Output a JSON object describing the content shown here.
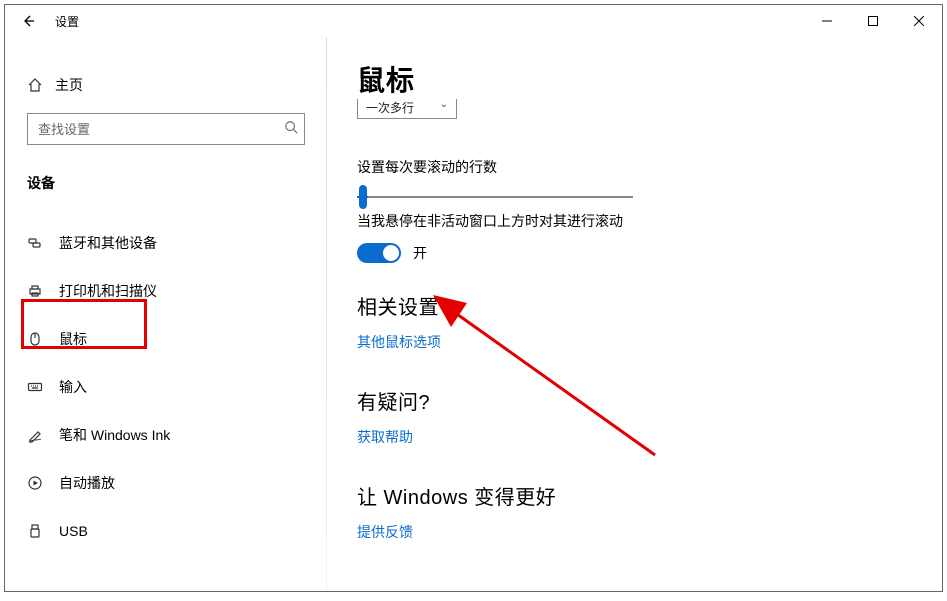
{
  "window": {
    "title": "设置"
  },
  "sidebar": {
    "home": "主页",
    "search_placeholder": "查找设置",
    "section": "设备",
    "items": [
      {
        "id": "bluetooth",
        "label": "蓝牙和其他设备"
      },
      {
        "id": "printers",
        "label": "打印机和扫描仪"
      },
      {
        "id": "mouse",
        "label": "鼠标"
      },
      {
        "id": "typing",
        "label": "输入"
      },
      {
        "id": "pen",
        "label": "笔和 Windows Ink"
      },
      {
        "id": "autoplay",
        "label": "自动播放"
      },
      {
        "id": "usb",
        "label": "USB"
      }
    ]
  },
  "content": {
    "heading": "鼠标",
    "dropdown": {
      "value": "一次多行"
    },
    "scroll_lines_label": "设置每次要滚动的行数",
    "inactive_scroll_label": "当我悬停在非活动窗口上方时对其进行滚动",
    "toggle_state": "开",
    "related": {
      "heading": "相关设置",
      "link": "其他鼠标选项"
    },
    "help": {
      "heading": "有疑问?",
      "link": "获取帮助"
    },
    "better": {
      "heading": "让 Windows 变得更好",
      "link": "提供反馈"
    }
  }
}
